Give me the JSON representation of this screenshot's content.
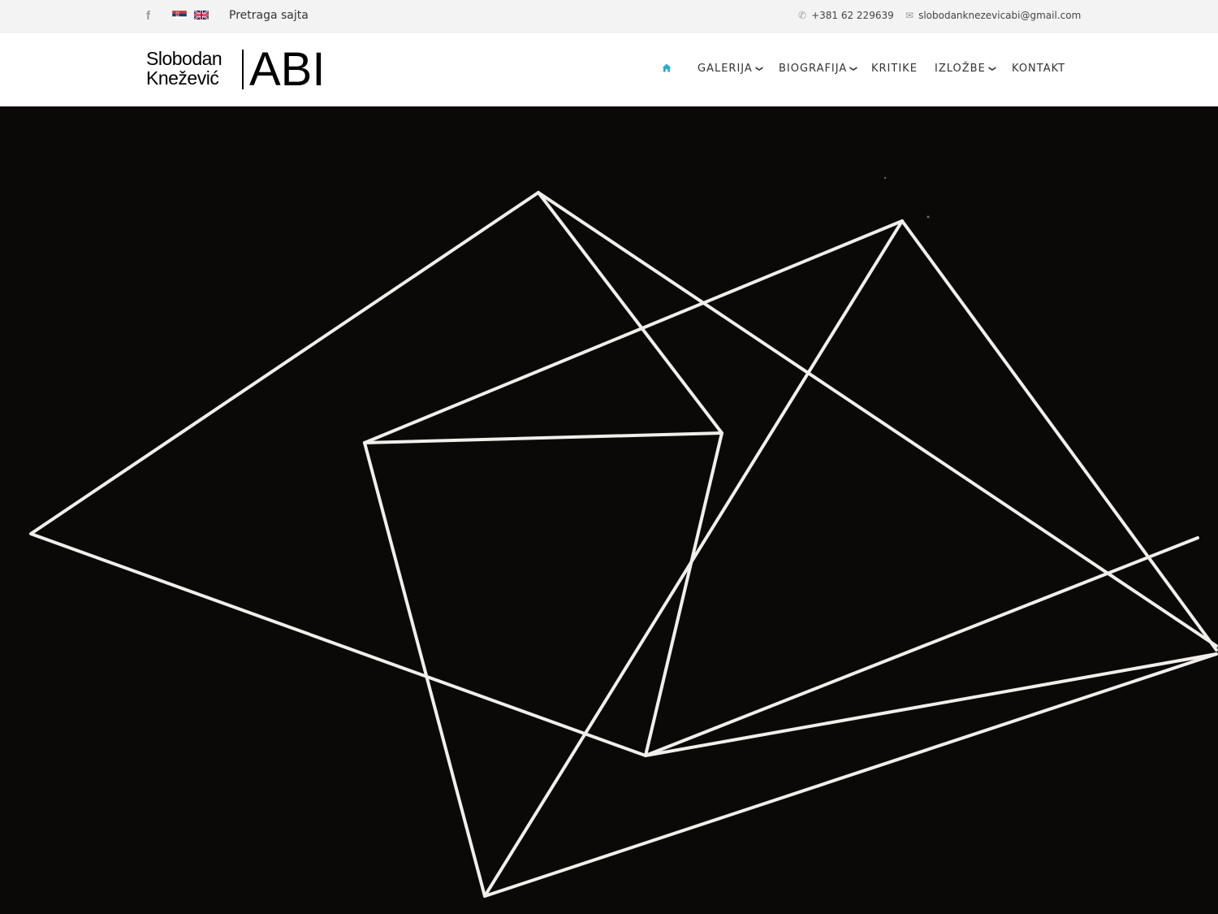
{
  "topbar": {
    "social_icon": "facebook-icon",
    "languages": [
      "sr",
      "en"
    ],
    "search_label": "Pretraga sajta",
    "phone": "+381 62 229639",
    "email": "slobodanknezevicabi@gmail.com",
    "phone_icon": "phone-icon",
    "email_icon": "envelope-icon"
  },
  "logo": {
    "first_name": "Slobodan",
    "last_name": "Knežević",
    "mark": "ABI"
  },
  "nav": {
    "home_icon": "home-icon",
    "items": [
      {
        "label": "GALERIJA",
        "dropdown": true
      },
      {
        "label": "BIOGRAFIJA",
        "dropdown": true
      },
      {
        "label": "KRITIKE",
        "dropdown": false
      },
      {
        "label": "IZLOŽBE",
        "dropdown": true
      },
      {
        "label": "KONTAKT",
        "dropdown": false
      }
    ],
    "accent_color": "#2aa8d8"
  },
  "hero": {
    "image": "white geometric line artwork on black",
    "background_color": "#0b0908",
    "line_color": "#f2efea"
  }
}
